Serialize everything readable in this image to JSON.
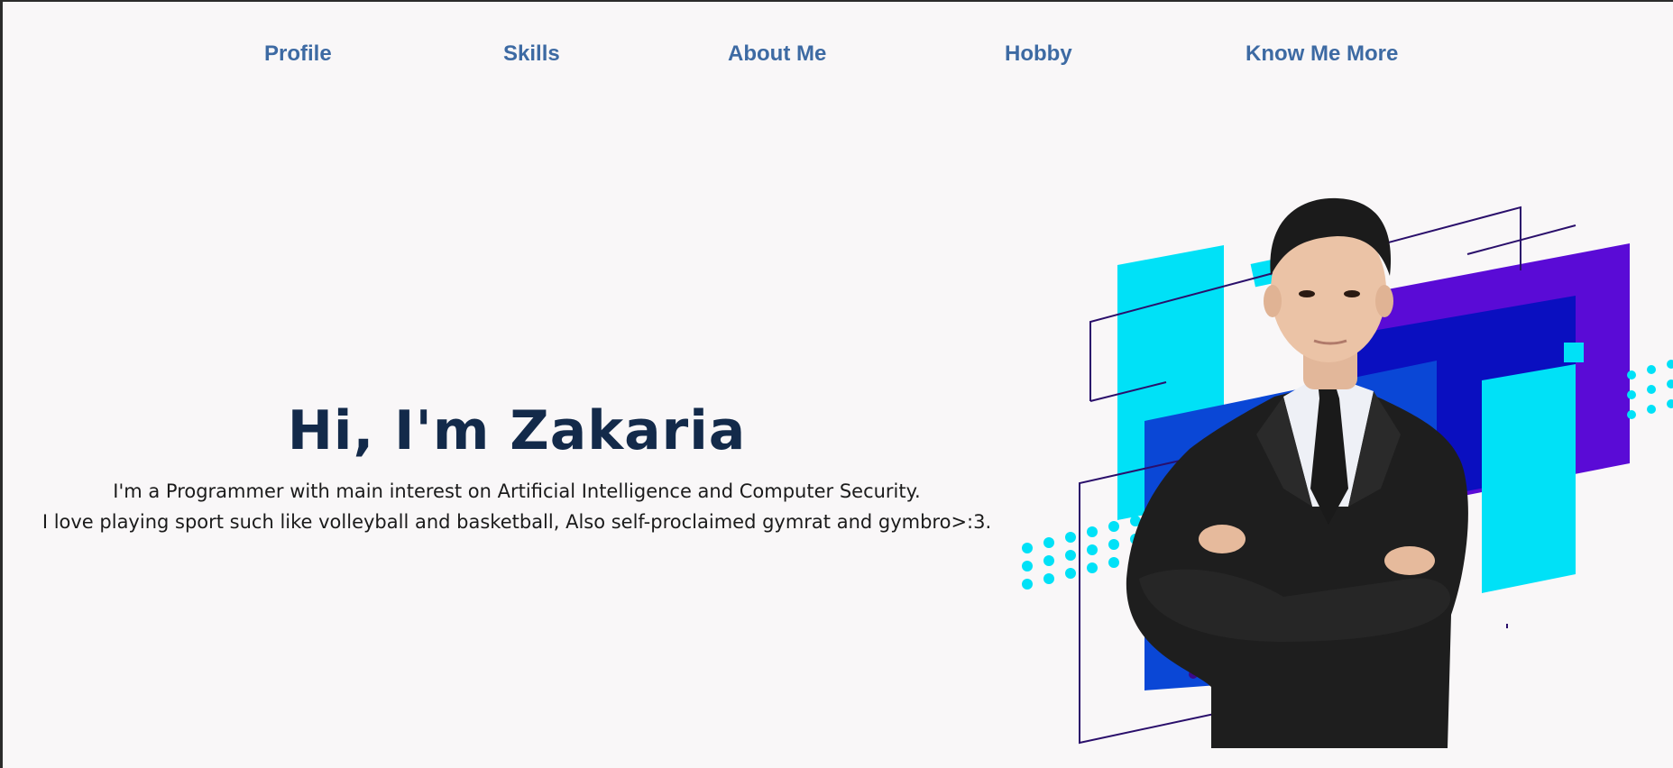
{
  "nav": {
    "items": [
      {
        "label": "Profile"
      },
      {
        "label": "Skills"
      },
      {
        "label": "About Me"
      },
      {
        "label": "Hobby"
      },
      {
        "label": "Know Me More"
      }
    ]
  },
  "hero": {
    "title": "Hi, I'm Zakaria",
    "line1": "I'm a Programmer with main interest on Artificial Intelligence and Computer Security.",
    "line2": "I love playing sport such like volleyball and basketball, Also self-proclaimed gymrat and gymbro>:3."
  },
  "colors": {
    "background": "#f9f7f8",
    "nav_link": "#3d6aa3",
    "title": "#132a4a",
    "cyan": "#00e1f7",
    "blue": "#0a47d6",
    "purple": "#5a0bd6",
    "navy": "#2a0f6b"
  }
}
